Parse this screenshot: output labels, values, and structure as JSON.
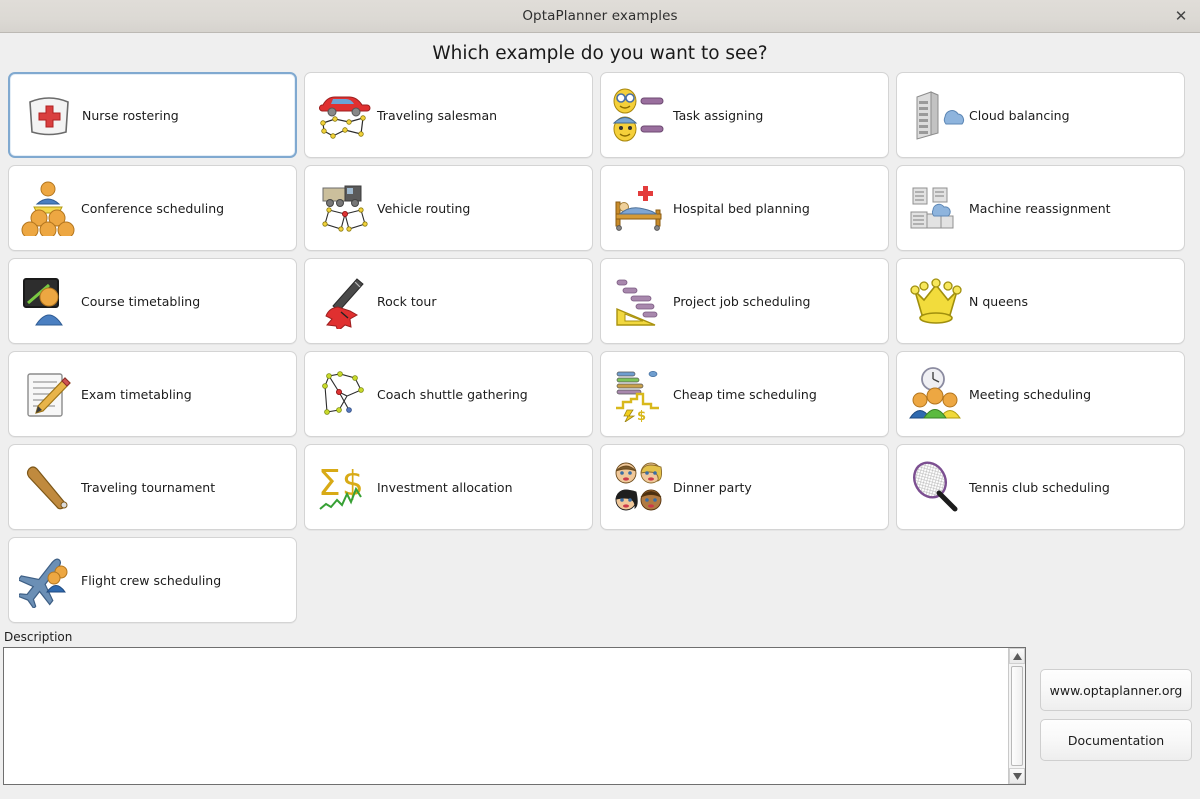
{
  "window": {
    "title": "OptaPlanner examples",
    "close_icon": "close-icon",
    "close_glyph": "✕"
  },
  "heading": "Which example do you want to see?",
  "examples": [
    {
      "label": "Nurse rostering",
      "icon": "nurse-hat-icon",
      "selected": true
    },
    {
      "label": "Traveling salesman",
      "icon": "car-route-icon",
      "selected": false
    },
    {
      "label": "Task assigning",
      "icon": "faces-tasks-icon",
      "selected": false
    },
    {
      "label": "Cloud balancing",
      "icon": "server-cloud-icon",
      "selected": false
    },
    {
      "label": "Conference scheduling",
      "icon": "speaker-audience-icon",
      "selected": false
    },
    {
      "label": "Vehicle routing",
      "icon": "truck-route-icon",
      "selected": false
    },
    {
      "label": "Hospital bed planning",
      "icon": "hospital-bed-icon",
      "selected": false
    },
    {
      "label": "Machine reassignment",
      "icon": "machines-cloud-icon",
      "selected": false
    },
    {
      "label": "Course timetabling",
      "icon": "blackboard-teacher-icon",
      "selected": false
    },
    {
      "label": "Rock tour",
      "icon": "electric-guitar-icon",
      "selected": false
    },
    {
      "label": "Project job scheduling",
      "icon": "gantt-ruler-icon",
      "selected": false
    },
    {
      "label": "N queens",
      "icon": "crown-icon",
      "selected": false
    },
    {
      "label": "Exam timetabling",
      "icon": "paper-pencil-icon",
      "selected": false
    },
    {
      "label": "Coach shuttle gathering",
      "icon": "graph-nodes-icon",
      "selected": false
    },
    {
      "label": "Cheap time scheduling",
      "icon": "bars-power-dollar-icon",
      "selected": false
    },
    {
      "label": "Meeting scheduling",
      "icon": "clock-people-icon",
      "selected": false
    },
    {
      "label": "Traveling tournament",
      "icon": "baseball-bat-icon",
      "selected": false
    },
    {
      "label": "Investment allocation",
      "icon": "sigma-dollar-chart-icon",
      "selected": false
    },
    {
      "label": "Dinner party",
      "icon": "four-faces-icon",
      "selected": false
    },
    {
      "label": "Tennis club scheduling",
      "icon": "tennis-racket-icon",
      "selected": false
    },
    {
      "label": "Flight crew scheduling",
      "icon": "airplane-crew-icon",
      "selected": false
    }
  ],
  "description": {
    "label": "Description",
    "value": "",
    "placeholder": ""
  },
  "buttons": {
    "website": "www.optaplanner.org",
    "documentation": "Documentation"
  },
  "colors": {
    "selection_border": "#80a9d0",
    "card_background": "#ffffff",
    "page_background": "#efefef",
    "titlebar_background": "#dcd9d4"
  }
}
